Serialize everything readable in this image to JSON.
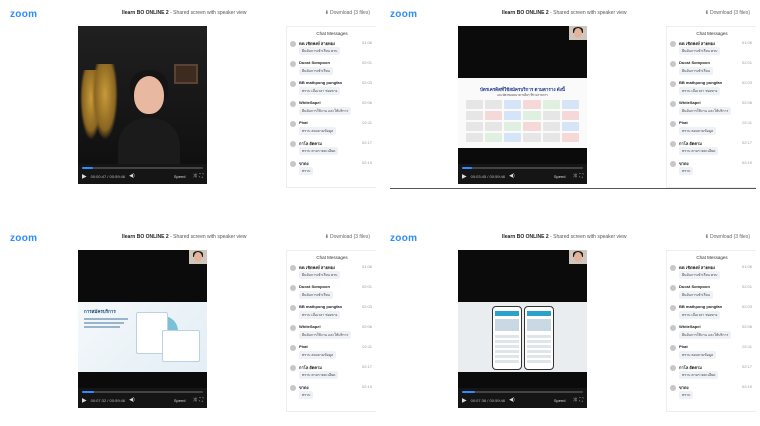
{
  "brand": "zoom",
  "accent": "#2D8CFF",
  "panels": [
    {
      "title_main": "Ilearn BO ONLINE 2",
      "title_sub": " - Shared screen with speaker view",
      "download": "Download (3 files)",
      "progress": 0.09,
      "time": "00:00:47 / 00:59:46",
      "speed": "Speed",
      "scene": "speaker"
    },
    {
      "title_main": "Ilearn BO ONLINE 2",
      "title_sub": " - Shared screen with speaker view",
      "download": "Download (3 files)",
      "progress": 0.08,
      "time": "00:03:45 / 00:59:46",
      "speed": "Speed",
      "scene": "logos",
      "slide_title": "บัตรเครดิตที่ใช้สมัครบริการ ตามตาราง ดังนี้",
      "slide_sub": "และบัตรของธนาคารอื่นๆ ที่ร่วมรายการ"
    },
    {
      "title_main": "Ilearn BO ONLINE 2",
      "title_sub": " - Shared screen with speaker view",
      "download": "Download (3 files)",
      "progress": 0.1,
      "time": "00:07:32 / 00:59:46",
      "speed": "Speed",
      "scene": "infographic",
      "slide_title": "การสมัครบริการ"
    },
    {
      "title_main": "Ilearn BO ONLINE 2",
      "title_sub": " - Shared screen with speaker view",
      "download": "Download (3 files)",
      "progress": 0.11,
      "time": "00:07:36 / 00:59:46",
      "speed": "Speed",
      "scene": "phones"
    }
  ],
  "chat": {
    "header": "Chat Messages",
    "messages": [
      {
        "name": "BB เชิดพงษ์ สายทอง",
        "time": "01:06",
        "text": "ยืนยันการเข้าเรียน ครบ"
      },
      {
        "name": "Duost Sompoon",
        "time": "02:01",
        "text": "ยืนยันการเข้าเรียน"
      },
      {
        "name": "BB mathpong pongfan",
        "time": "02:03",
        "text": "ทราบ เมื่อเวลา ช่องทาง"
      },
      {
        "name": "WhiteSapel",
        "time": "02:06",
        "text": "ยืนยันการใช้งาน และให้บริการ"
      },
      {
        "name": "Phat",
        "time": "02:11",
        "text": "ทราบ สอบถามข้อมูล"
      },
      {
        "name": "กาโล ยัตคาม",
        "time": "02:17",
        "text": "ทราบ ตามรายละเอียด"
      },
      {
        "name": "ขาดง",
        "time": "02:19",
        "text": "ทราบ"
      }
    ]
  }
}
